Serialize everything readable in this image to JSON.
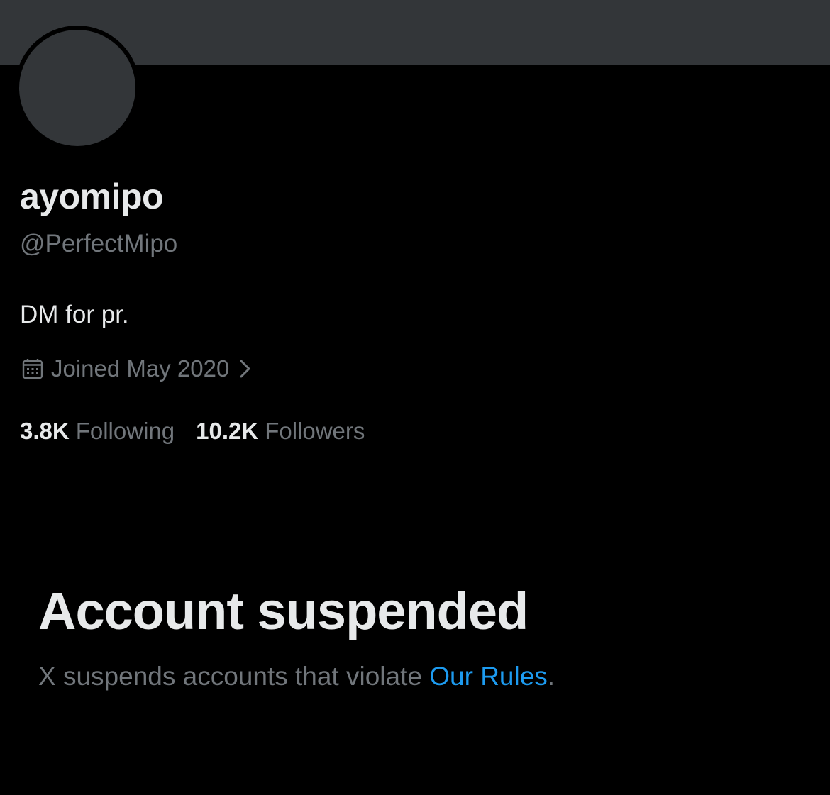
{
  "profile": {
    "display_name": "ayomipo",
    "handle": "@PerfectMipo",
    "bio": "DM for pr.",
    "joined": "Joined May 2020",
    "joined_icon": "calendar-icon",
    "chevron_icon": "chevron-right-icon"
  },
  "stats": {
    "following_count": "3.8K",
    "following_label": "Following",
    "followers_count": "10.2K",
    "followers_label": "Followers"
  },
  "suspension": {
    "title": "Account suspended",
    "message_prefix": "X suspends accounts that violate ",
    "link_text": "Our Rules",
    "message_suffix": "."
  },
  "colors": {
    "background": "#000000",
    "banner": "#333639",
    "primary_text": "#e7e9ea",
    "secondary_text": "#71767b",
    "link": "#1d9bf0"
  }
}
